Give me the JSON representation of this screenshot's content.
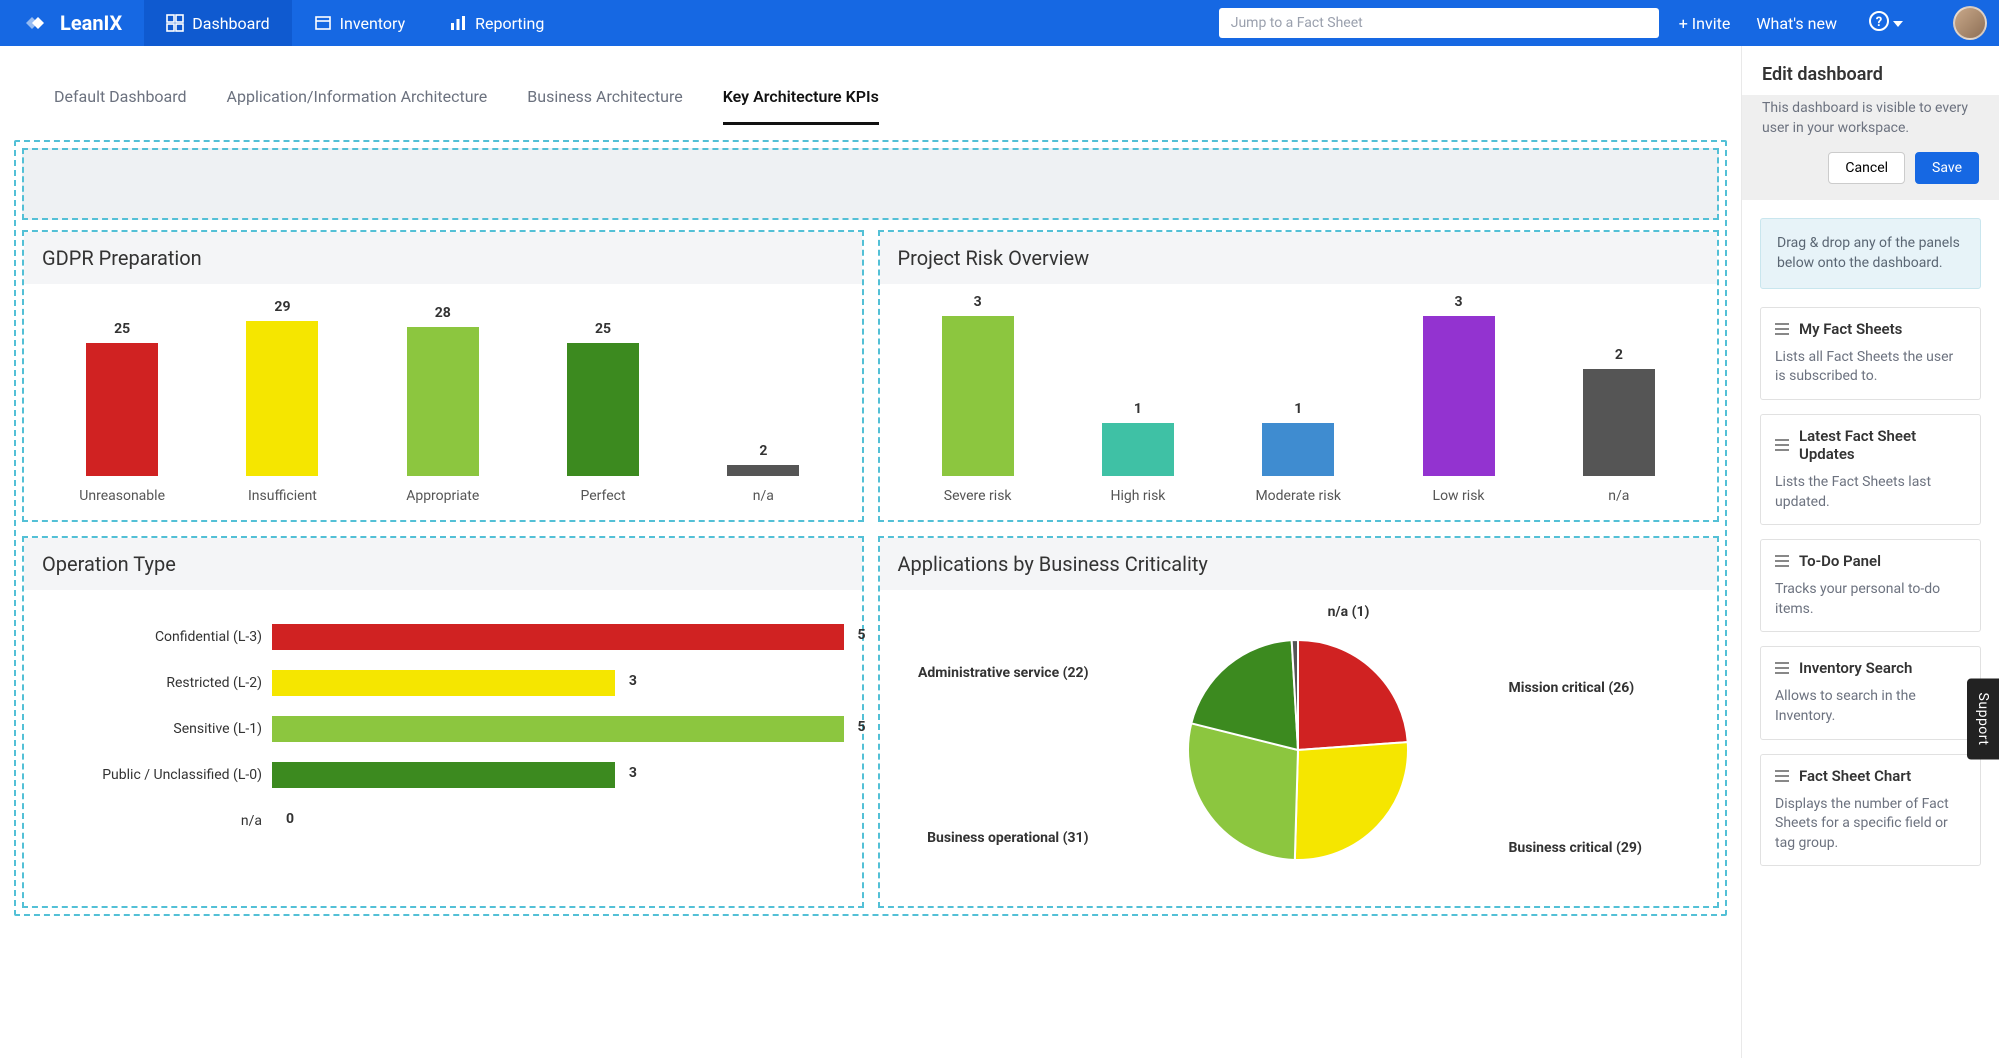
{
  "brand": "LeanIX",
  "nav": {
    "items": [
      {
        "label": "Dashboard",
        "active": true,
        "icon": "dashboard"
      },
      {
        "label": "Inventory",
        "active": false,
        "icon": "inventory"
      },
      {
        "label": "Reporting",
        "active": false,
        "icon": "reporting"
      }
    ],
    "search_placeholder": "Jump to a Fact Sheet",
    "invite": "+ Invite",
    "whatsnew": "What's new"
  },
  "subtabs": [
    {
      "label": "Default Dashboard",
      "active": false
    },
    {
      "label": "Application/Information Architecture",
      "active": false
    },
    {
      "label": "Business Architecture",
      "active": false
    },
    {
      "label": "Key Architecture KPIs",
      "active": true
    }
  ],
  "edit": {
    "title": "Edit dashboard",
    "note": "This dashboard is visible to every user in your workspace.",
    "cancel": "Cancel",
    "save": "Save",
    "tip": "Drag & drop any of the panels below onto the dashboard.",
    "panels": [
      {
        "title": "My Fact Sheets",
        "desc": "Lists all Fact Sheets the user is subscribed to."
      },
      {
        "title": "Latest Fact Sheet Updates",
        "desc": "Lists the Fact Sheets last updated."
      },
      {
        "title": "To-Do Panel",
        "desc": "Tracks your personal to-do items."
      },
      {
        "title": "Inventory Search",
        "desc": "Allows to search in the Inventory."
      },
      {
        "title": "Fact Sheet Chart",
        "desc": "Displays the number of Fact Sheets for a specific field or tag group."
      }
    ]
  },
  "support": "Support",
  "charts": {
    "gdpr": {
      "title": "GDPR Preparation",
      "type": "bar",
      "categories": [
        "Unreasonable",
        "Insufficient",
        "Appropriate",
        "Perfect",
        "n/a"
      ],
      "values": [
        25,
        29,
        28,
        25,
        2
      ],
      "colors": [
        "#d02222",
        "#f5e600",
        "#8cc63f",
        "#3c8a1f",
        "#555555"
      ],
      "ylim": [
        0,
        30
      ]
    },
    "risk": {
      "title": "Project Risk Overview",
      "type": "bar",
      "categories": [
        "Severe risk",
        "High risk",
        "Moderate risk",
        "Low risk",
        "n/a"
      ],
      "values": [
        3,
        1,
        1,
        3,
        2
      ],
      "colors": [
        "#8cc63f",
        "#3fc1a5",
        "#3f8cd0",
        "#9333d0",
        "#555555"
      ],
      "ylim": [
        0,
        3
      ]
    },
    "optype": {
      "title": "Operation Type",
      "type": "hbar",
      "categories": [
        "Confidential (L-3)",
        "Restricted (L-2)",
        "Sensitive (L-1)",
        "Public / Unclassified (L-0)",
        "n/a"
      ],
      "values": [
        5,
        3,
        5,
        3,
        0
      ],
      "colors": [
        "#d02222",
        "#f5e600",
        "#8cc63f",
        "#3c8a1f",
        "#555555"
      ],
      "xlim": [
        0,
        5
      ]
    },
    "criticality": {
      "title": "Applications by Business Criticality",
      "type": "pie",
      "slices": [
        {
          "label": "Mission critical",
          "value": 26,
          "color": "#d02222"
        },
        {
          "label": "Business critical",
          "value": 29,
          "color": "#f5e600"
        },
        {
          "label": "Business operational",
          "value": 31,
          "color": "#8cc63f"
        },
        {
          "label": "Administrative service",
          "value": 22,
          "color": "#3c8a1f"
        },
        {
          "label": "n/a",
          "value": 1,
          "color": "#555555"
        }
      ]
    }
  },
  "chart_data": [
    {
      "type": "bar",
      "title": "GDPR Preparation",
      "categories": [
        "Unreasonable",
        "Insufficient",
        "Appropriate",
        "Perfect",
        "n/a"
      ],
      "values": [
        25,
        29,
        28,
        25,
        2
      ],
      "ylim": [
        0,
        30
      ]
    },
    {
      "type": "bar",
      "title": "Project Risk Overview",
      "categories": [
        "Severe risk",
        "High risk",
        "Moderate risk",
        "Low risk",
        "n/a"
      ],
      "values": [
        3,
        1,
        1,
        3,
        2
      ],
      "ylim": [
        0,
        3
      ]
    },
    {
      "type": "bar",
      "orientation": "horizontal",
      "title": "Operation Type",
      "categories": [
        "Confidential (L-3)",
        "Restricted (L-2)",
        "Sensitive (L-1)",
        "Public / Unclassified (L-0)",
        "n/a"
      ],
      "values": [
        5,
        3,
        5,
        3,
        0
      ],
      "xlim": [
        0,
        5
      ]
    },
    {
      "type": "pie",
      "title": "Applications by Business Criticality",
      "series": [
        {
          "name": "Mission critical",
          "value": 26
        },
        {
          "name": "Business critical",
          "value": 29
        },
        {
          "name": "Business operational",
          "value": 31
        },
        {
          "name": "Administrative service",
          "value": 22
        },
        {
          "name": "n/a",
          "value": 1
        }
      ]
    }
  ]
}
